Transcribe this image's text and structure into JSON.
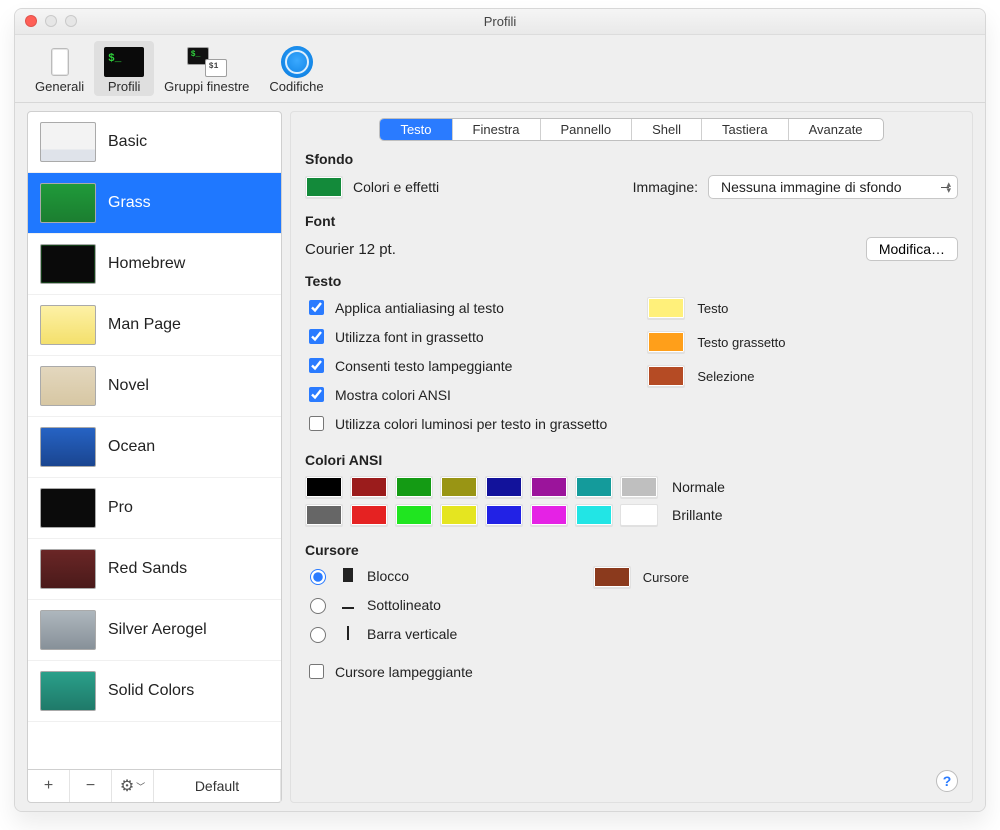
{
  "window": {
    "title": "Profili"
  },
  "toolbar": {
    "items": [
      {
        "label": "Generali"
      },
      {
        "label": "Profili"
      },
      {
        "label": "Gruppi finestre"
      },
      {
        "label": "Codifiche"
      }
    ]
  },
  "sidebar": {
    "items": [
      {
        "label": "Basic"
      },
      {
        "label": "Grass"
      },
      {
        "label": "Homebrew"
      },
      {
        "label": "Man Page"
      },
      {
        "label": "Novel"
      },
      {
        "label": "Ocean"
      },
      {
        "label": "Pro"
      },
      {
        "label": "Red Sands"
      },
      {
        "label": "Silver Aerogel"
      },
      {
        "label": "Solid Colors"
      }
    ],
    "selected": "Grass",
    "footer": {
      "add": "+",
      "remove": "−",
      "gear": "⚙︎",
      "default_label": "Default"
    }
  },
  "tabs": [
    {
      "label": "Testo"
    },
    {
      "label": "Finestra"
    },
    {
      "label": "Pannello"
    },
    {
      "label": "Shell"
    },
    {
      "label": "Tastiera"
    },
    {
      "label": "Avanzate"
    }
  ],
  "sections": {
    "sfondo": {
      "title": "Sfondo",
      "color": "#138a3a",
      "effects_label": "Colori e effetti",
      "image_label": "Immagine:",
      "image_popup": "Nessuna immagine di sfondo"
    },
    "font": {
      "title": "Font",
      "description": "Courier 12 pt.",
      "button": "Modifica…"
    },
    "testo": {
      "title": "Testo",
      "checks": [
        {
          "label": "Applica antialiasing al testo",
          "checked": true
        },
        {
          "label": "Utilizza font in grassetto",
          "checked": true
        },
        {
          "label": "Consenti testo lampeggiante",
          "checked": true
        },
        {
          "label": "Mostra colori ANSI",
          "checked": true
        },
        {
          "label": "Utilizza colori luminosi per testo in grassetto",
          "checked": false
        }
      ],
      "colors": [
        {
          "label": "Testo",
          "value": "#fff07a"
        },
        {
          "label": "Testo grassetto",
          "value": "#ff9f1a"
        },
        {
          "label": "Selezione",
          "value": "#b54b24"
        }
      ]
    },
    "ansi": {
      "title": "Colori ANSI",
      "normal_label": "Normale",
      "bright_label": "Brillante",
      "normal": [
        "#000000",
        "#9b1c1c",
        "#149b14",
        "#999514",
        "#12129b",
        "#9b149b",
        "#149b9b",
        "#bfbfbf"
      ],
      "bright": [
        "#666666",
        "#e52222",
        "#20e520",
        "#e5e520",
        "#2222e5",
        "#e522e5",
        "#22e5e5",
        "#ffffff"
      ]
    },
    "cursore": {
      "title": "Cursore",
      "radios": [
        {
          "label": "Blocco"
        },
        {
          "label": "Sottolineato"
        },
        {
          "label": "Barra verticale"
        }
      ],
      "cursor_color_label": "Cursore",
      "cursor_color": "#8b3a1d",
      "blink_label": "Cursore lampeggiante",
      "blink_checked": false
    }
  },
  "help": "?"
}
